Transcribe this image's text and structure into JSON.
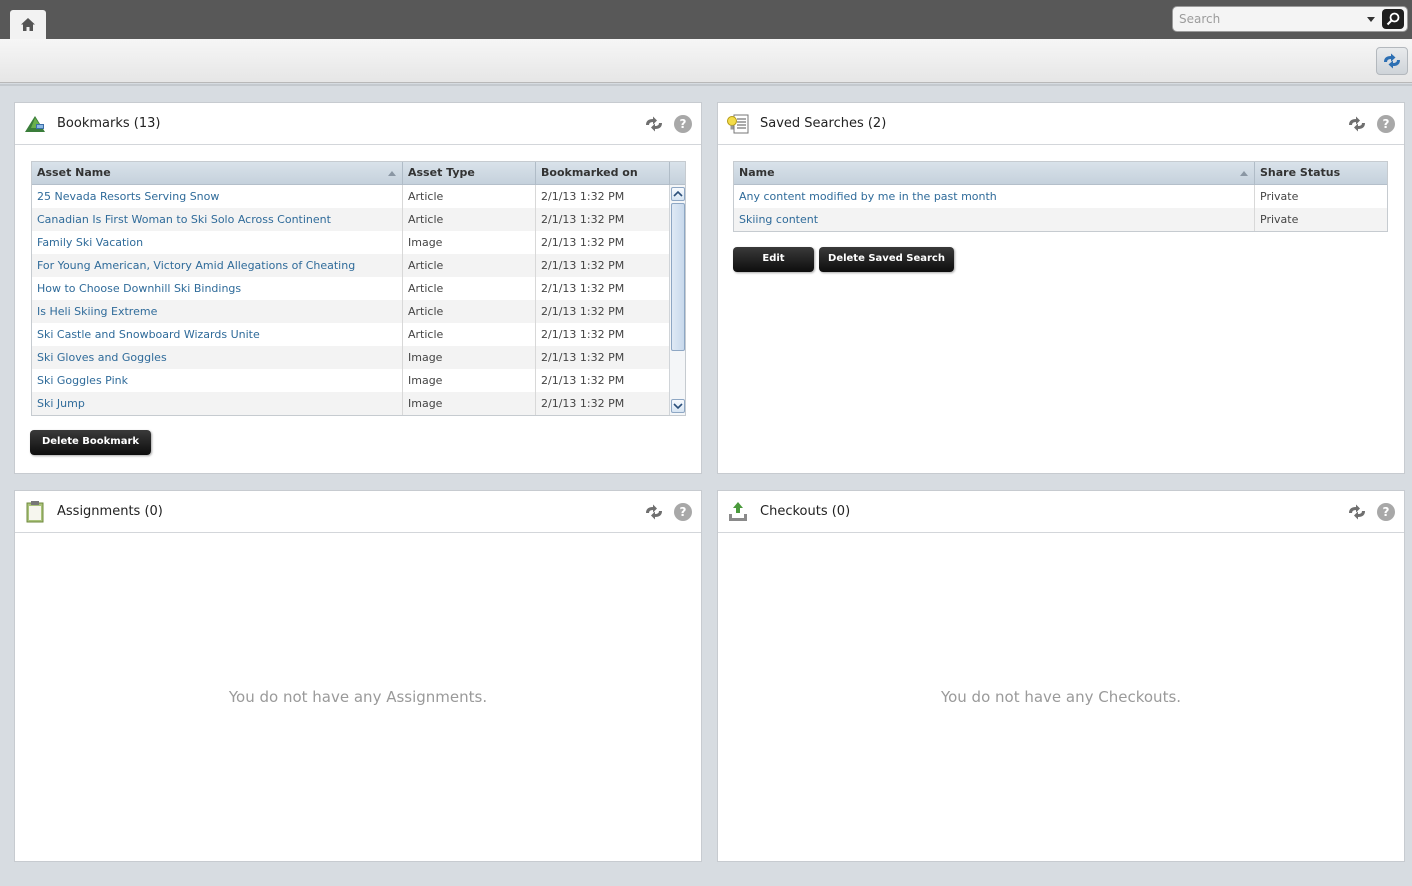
{
  "search": {
    "placeholder": "Search"
  },
  "bookmarks": {
    "title": "Bookmarks (13)",
    "columns": [
      "Asset Name",
      "Asset Type",
      "Bookmarked on"
    ],
    "rows": [
      [
        "25 Nevada Resorts Serving Snow",
        "Article",
        "2/1/13 1:32 PM"
      ],
      [
        "Canadian Is First Woman to Ski Solo Across Continent",
        "Article",
        "2/1/13 1:32 PM"
      ],
      [
        "Family Ski Vacation",
        "Image",
        "2/1/13 1:32 PM"
      ],
      [
        "For Young American, Victory Amid Allegations of Cheating",
        "Article",
        "2/1/13 1:32 PM"
      ],
      [
        "How to Choose Downhill Ski Bindings",
        "Article",
        "2/1/13 1:32 PM"
      ],
      [
        "Is Heli Skiing Extreme",
        "Article",
        "2/1/13 1:32 PM"
      ],
      [
        "Ski Castle and Snowboard Wizards Unite",
        "Article",
        "2/1/13 1:32 PM"
      ],
      [
        "Ski Gloves and Goggles",
        "Image",
        "2/1/13 1:32 PM"
      ],
      [
        "Ski Goggles Pink",
        "Image",
        "2/1/13 1:32 PM"
      ],
      [
        "Ski Jump",
        "Image",
        "2/1/13 1:32 PM"
      ]
    ],
    "delete_label": "Delete Bookmark"
  },
  "saved_searches": {
    "title": "Saved Searches (2)",
    "columns": [
      "Name",
      "Share Status"
    ],
    "rows": [
      [
        "Any content modified by me in the past month",
        "Private"
      ],
      [
        "Skiing content",
        "Private"
      ]
    ],
    "edit_label": "Edit",
    "delete_label": "Delete Saved Search"
  },
  "assignments": {
    "title": "Assignments (0)",
    "empty_message": "You do not have any Assignments."
  },
  "checkouts": {
    "title": "Checkouts (0)",
    "empty_message": "You do not have any Checkouts."
  },
  "colors": {
    "topbar": "#585858",
    "link": "#2f6b9a",
    "background": "#d7dce1"
  }
}
